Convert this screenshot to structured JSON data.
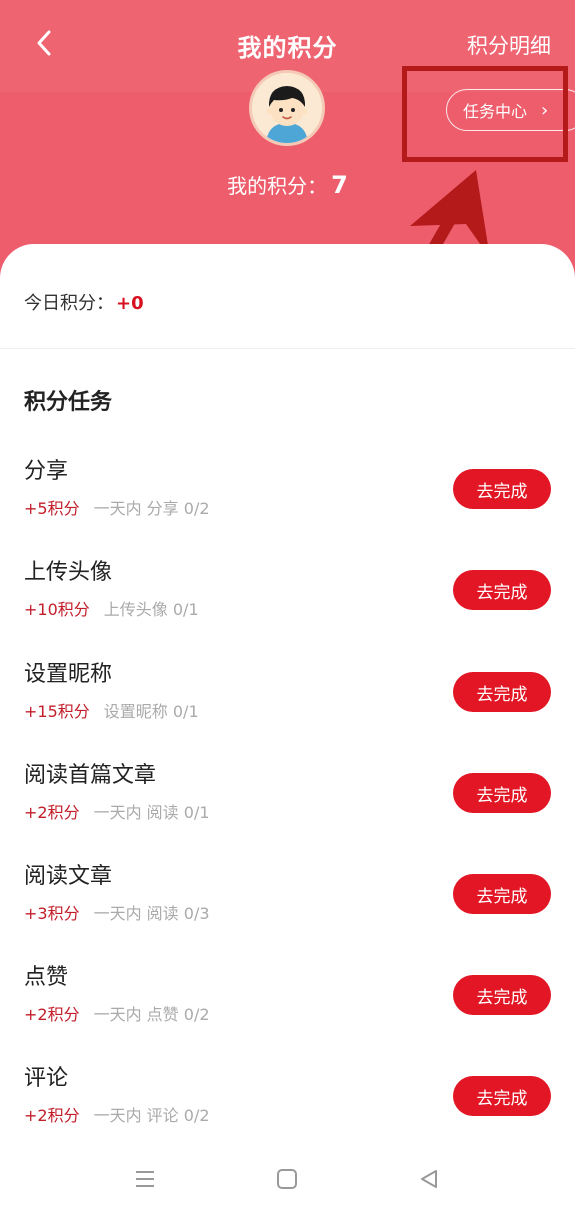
{
  "header": {
    "title": "我的积分",
    "detail_link": "积分明细",
    "points_label": "我的积分：",
    "points_value": "7",
    "task_center": "任务中心",
    "back_icon": "chevron-left-icon",
    "avatar_icon": "boy-avatar",
    "colors": {
      "header_bg": "#ee5d6c",
      "accent": "#e21624",
      "highlight": "#b41a1a"
    }
  },
  "today": {
    "label": "今日积分：",
    "value": "+0"
  },
  "tasks_section": {
    "title": "积分任务",
    "button_label": "去完成",
    "items": [
      {
        "name": "分享",
        "reward": "+5积分",
        "desc": "一天内 分享 0/2"
      },
      {
        "name": "上传头像",
        "reward": "+10积分",
        "desc": "上传头像 0/1"
      },
      {
        "name": "设置昵称",
        "reward": "+15积分",
        "desc": "设置昵称 0/1"
      },
      {
        "name": "阅读首篇文章",
        "reward": "+2积分",
        "desc": "一天内 阅读 0/1"
      },
      {
        "name": "阅读文章",
        "reward": "+3积分",
        "desc": "一天内 阅读 0/3"
      },
      {
        "name": "点赞",
        "reward": "+2积分",
        "desc": "一天内 点赞 0/2"
      },
      {
        "name": "评论",
        "reward": "+2积分",
        "desc": "一天内 评论 0/2"
      }
    ]
  },
  "navbar": {
    "icons": [
      "menu-icon",
      "home-square-icon",
      "back-triangle-icon"
    ]
  }
}
